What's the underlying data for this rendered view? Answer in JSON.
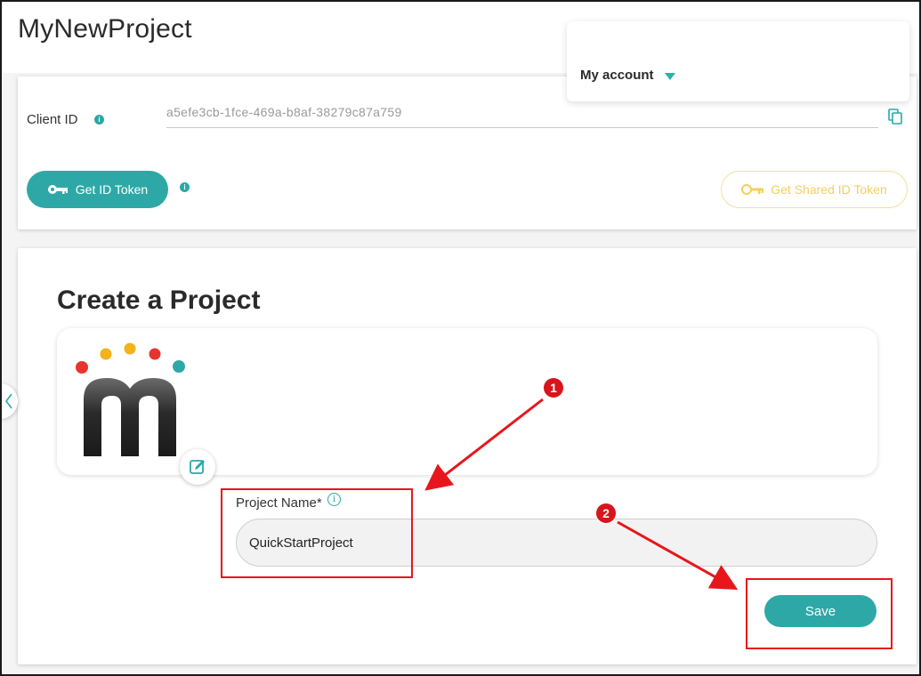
{
  "header": {
    "project_title": "MyNewProject",
    "account_label": "My account"
  },
  "credentials": {
    "client_id_label": "Client ID",
    "client_id_value": "a5efe3cb-1fce-469a-b8af-38279c87a759",
    "get_id_token_label": "Get ID Token",
    "get_shared_id_token_label": "Get Shared ID Token"
  },
  "create_project": {
    "title": "Create a Project",
    "project_name_label": "Project Name*",
    "project_name_value": "QuickStartProject",
    "save_label": "Save"
  },
  "annotations": {
    "step1": "1",
    "step2": "2"
  },
  "icons": {
    "info": "info-icon",
    "copy": "copy-icon",
    "key": "key-icon",
    "edit": "edit-icon",
    "caret": "caret-down-icon",
    "collapse": "chevron-left-icon"
  },
  "colors": {
    "accent": "#2ea8a6",
    "shared_button": "#f3cf5e",
    "annotation_red": "#e8161c"
  }
}
